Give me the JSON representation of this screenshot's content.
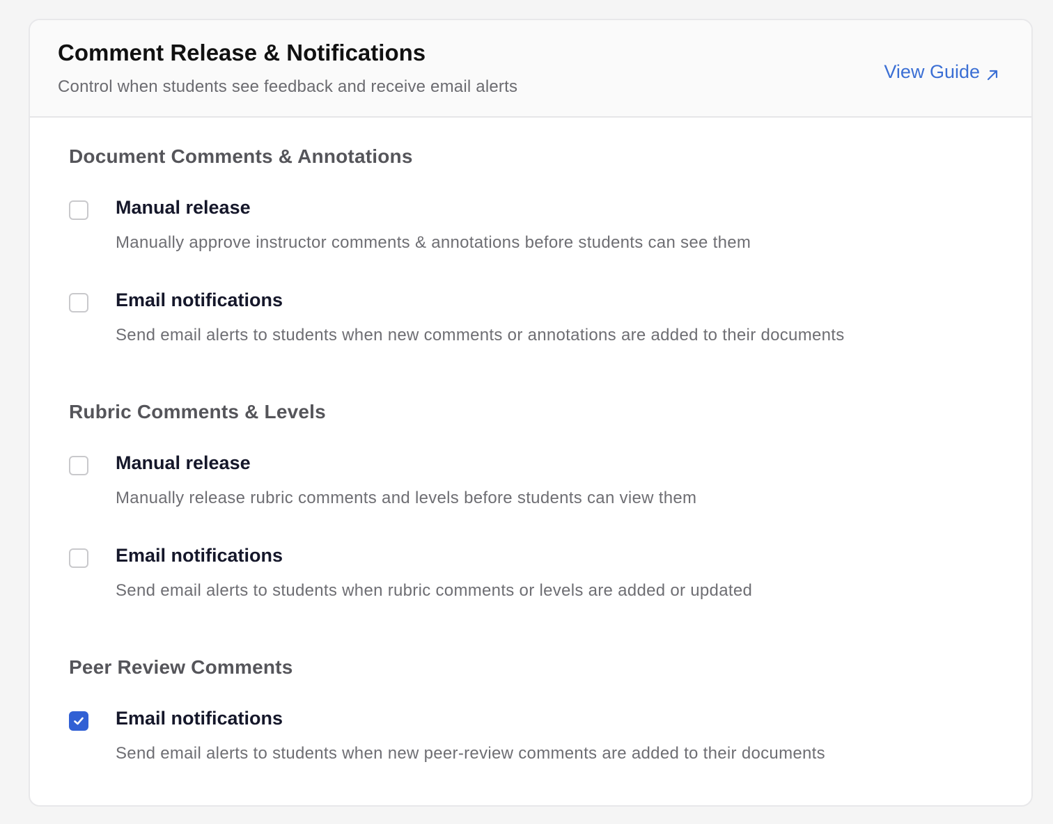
{
  "header": {
    "title": "Comment Release & Notifications",
    "subtitle": "Control when students see feedback and receive email alerts",
    "guide_link": "View Guide",
    "guide_icon": "external-arrow-icon"
  },
  "colors": {
    "accent": "#3160d4",
    "link": "#3b6fd4"
  },
  "sections": [
    {
      "title": "Document Comments & Annotations",
      "options": [
        {
          "label": "Manual release",
          "description": "Manually approve instructor comments & annotations before students can see them",
          "checked": false
        },
        {
          "label": "Email notifications",
          "description": "Send email alerts to students when new comments or annotations are added to their documents",
          "checked": false
        }
      ]
    },
    {
      "title": "Rubric Comments & Levels",
      "options": [
        {
          "label": "Manual release",
          "description": "Manually release rubric comments and levels before students can view them",
          "checked": false
        },
        {
          "label": "Email notifications",
          "description": "Send email alerts to students when rubric comments or levels are added or updated",
          "checked": false
        }
      ]
    },
    {
      "title": "Peer Review Comments",
      "options": [
        {
          "label": "Email notifications",
          "description": "Send email alerts to students when new peer-review comments are added to their documents",
          "checked": true
        }
      ]
    }
  ]
}
